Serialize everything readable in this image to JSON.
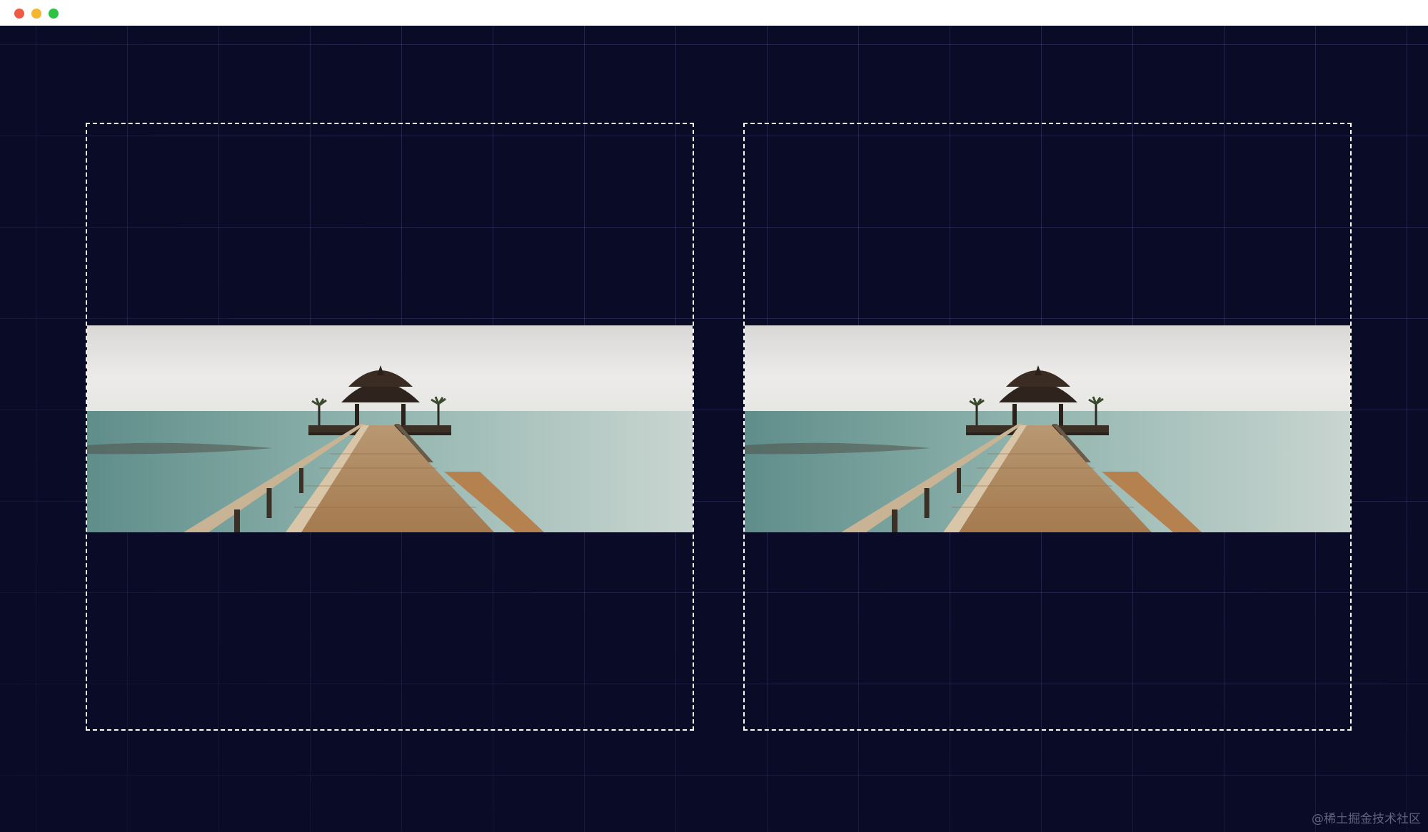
{
  "window": {
    "controls": [
      {
        "name": "close",
        "color": "#ee5a44"
      },
      {
        "name": "minimize",
        "color": "#f5b52e"
      },
      {
        "name": "maximize",
        "color": "#2dc23f"
      }
    ]
  },
  "canvas": {
    "background_color": "#0a0b26",
    "grid": true
  },
  "frames": [
    {
      "id": "left",
      "border_style": "dashed",
      "border_color": "#ffffff",
      "image": "pier-gazebo-ocean-photo"
    },
    {
      "id": "right",
      "border_style": "dashed",
      "border_color": "#ffffff",
      "image": "pier-gazebo-ocean-photo"
    }
  ],
  "watermark": "@稀土掘金技术社区"
}
